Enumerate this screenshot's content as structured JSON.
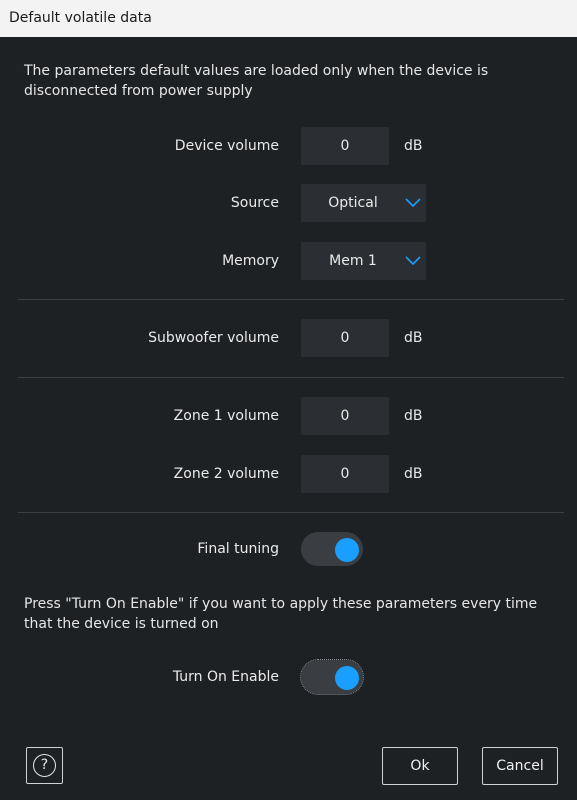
{
  "window": {
    "title": "Default volatile data"
  },
  "intro_text": "The parameters default values are loaded only when the device is disconnected from power supply",
  "device_volume": {
    "label": "Device volume",
    "value": "0",
    "unit": "dB"
  },
  "source": {
    "label": "Source",
    "value": "Optical"
  },
  "memory": {
    "label": "Memory",
    "value": "Mem 1"
  },
  "subwoofer_volume": {
    "label": "Subwoofer volume",
    "value": "0",
    "unit": "dB"
  },
  "zone1_volume": {
    "label": "Zone 1 volume",
    "value": "0",
    "unit": "dB"
  },
  "zone2_volume": {
    "label": "Zone 2 volume",
    "value": "0",
    "unit": "dB"
  },
  "final_tuning": {
    "label": "Final tuning",
    "on": true
  },
  "turn_on_note": "Press \"Turn On Enable\" if you want to apply these parameters every time that the device is turned on",
  "turn_on_enable": {
    "label": "Turn On Enable",
    "on": true
  },
  "footer": {
    "help_glyph": "?",
    "ok_label": "Ok",
    "cancel_label": "Cancel"
  },
  "colors": {
    "accent": "#1a9fff",
    "background": "#1e2124",
    "field": "#2b2f33",
    "titlebar": "#f3f3f3"
  },
  "icons": {
    "dropdown": "chevron-down-icon",
    "help": "help-icon"
  }
}
